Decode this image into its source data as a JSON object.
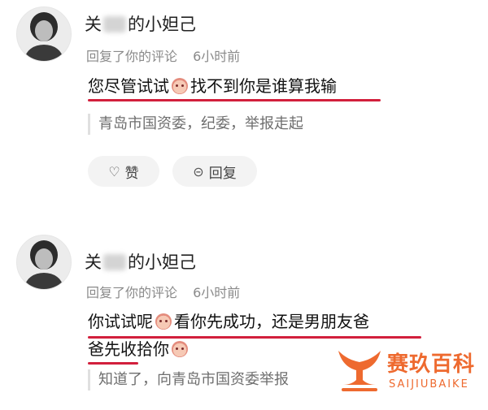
{
  "comments": [
    {
      "username_prefix": "关",
      "username_suffix": "的小妲己",
      "action": "回复了你的评论",
      "time": "6小时前",
      "text_before_emoji": "您尽管试试",
      "text_after_emoji": "找不到你是谁算我输",
      "quote": "青岛市国资委，纪委，举报走起",
      "like_label": "赞",
      "reply_label": "回复"
    },
    {
      "username_prefix": "关",
      "username_suffix": "的小妲己",
      "action": "回复了你的评论",
      "time": "6小时前",
      "line1_before_emoji": "你试试呢",
      "line1_after_emoji": "看你先成功，还是男朋友爸",
      "line2_before_emoji": "爸先收拾你",
      "quote": "知道了，向青岛市国资委举报"
    }
  ],
  "watermark": {
    "title": "赛玖百科",
    "subtitle": "SAIJIUBAIKE"
  },
  "colors": {
    "underline": "#d21f3c",
    "watermark": "#ee6a2f",
    "meta": "#8a8a8a"
  },
  "icons": [
    "heart-outline-icon",
    "comment-bubble-icon",
    "emoji-icon"
  ]
}
